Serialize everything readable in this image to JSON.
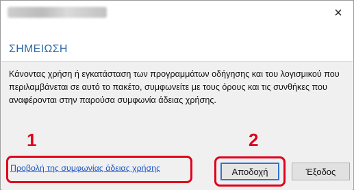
{
  "window": {
    "title": "",
    "close_glyph": "×"
  },
  "notice": {
    "heading": "ΣΗΜΕΙΩΣΗ",
    "message": "Κάνοντας χρήση ή εγκατάσταση των προγραμμάτων οδήγησης και του λογισμικού που περιλαμβάνεται σε αυτό το πακέτο, συμφωνείτε με τους όρους και τις συνθήκες που αναφέρονται στην παρούσα συμφωνία άδειας χρήσης."
  },
  "annotations": {
    "step1": "1",
    "step2": "2",
    "highlight_color": "#e0001a"
  },
  "links": {
    "view_license": "Προβολή της συμφωνίας άδειας χρήσης"
  },
  "buttons": {
    "accept": "Αποδοχή",
    "exit": "Έξοδος"
  },
  "icons": {
    "close": "close-icon"
  }
}
